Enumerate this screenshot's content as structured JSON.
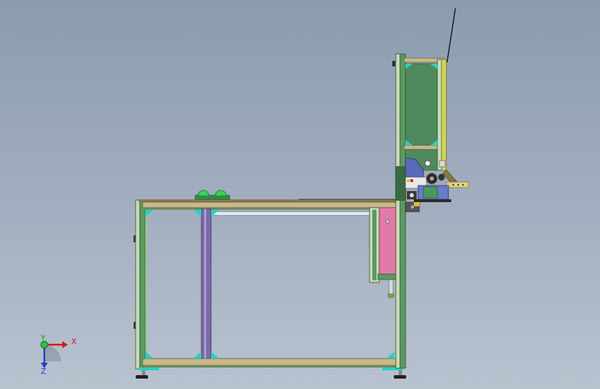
{
  "viewport": {
    "background_top": "#8c9bb0",
    "background_bottom": "#b9c2cf"
  },
  "model": {
    "frame_color": "#5a9a62",
    "frame_light": "#c9dcb8",
    "profile_color": "#c8b88a",
    "panel_green": "#4f8a5e",
    "panel_pink": "#e07aa8",
    "cylinder_purple": "#7a6aa8",
    "bracket_cyan": "#2ad0c0"
  },
  "triad": {
    "x_label": "X",
    "y_label": "Y",
    "z_label": "Z",
    "x_color": "#d01818",
    "y_color": "#18a018",
    "z_color": "#2040c0"
  }
}
